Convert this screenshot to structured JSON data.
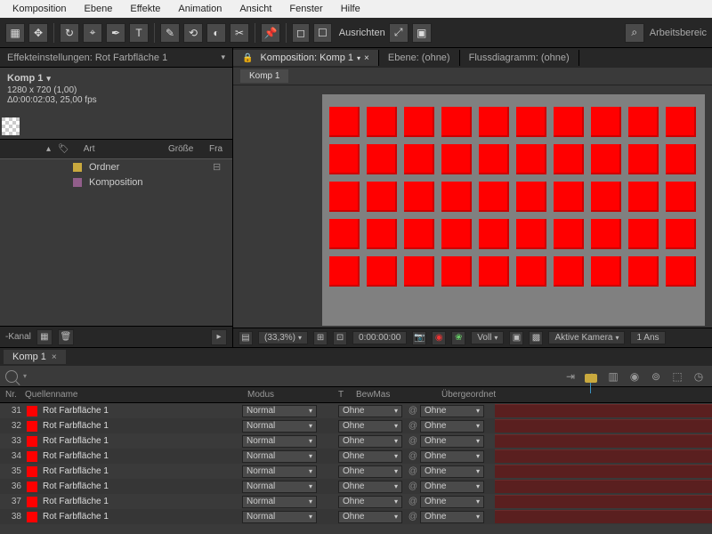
{
  "menu": [
    "Komposition",
    "Ebene",
    "Effekte",
    "Animation",
    "Ansicht",
    "Fenster",
    "Hilfe"
  ],
  "toolbar": {
    "ausrichten": "Ausrichten",
    "arbeitsbereich": "Arbeitsbereic"
  },
  "fx": {
    "title": "Effekteinstellungen: Rot Farbfläche 1"
  },
  "comp": {
    "name": "Komp 1",
    "dims": "1280 x 720 (1,00)",
    "fps": "Δ0:00:02:03, 25,00 fps"
  },
  "proj": {
    "cols": {
      "art": "Art",
      "size": "Größe",
      "fr": "Fra"
    },
    "items": [
      {
        "name": "Ordner",
        "kind": "folder"
      },
      {
        "name": "Komposition",
        "kind": "comp"
      }
    ],
    "kanal": "-Kanal"
  },
  "viewerTabs": {
    "komp": "Komposition: Komp 1",
    "ebene": "Ebene: (ohne)",
    "fluss": "Flussdiagramm: (ohne)",
    "subtab": "Komp 1"
  },
  "viewerFoot": {
    "zoom": "(33,3%)",
    "time": "0:00:00:00",
    "voll": "Voll",
    "cam": "Aktive Kamera",
    "ans": "1 Ans"
  },
  "timeline": {
    "tab": "Komp 1",
    "cols": {
      "nr": "Nr.",
      "name": "Quellenname",
      "mode": "Modus",
      "t": "T",
      "bew": "BewMas",
      "parent": "Übergeordnet"
    },
    "modeVal": "Normal",
    "bewVal": "Ohne",
    "parVal": "Ohne",
    "rows": [
      {
        "nr": "31",
        "name": "Rot Farbfläche 1"
      },
      {
        "nr": "32",
        "name": "Rot Farbfläche 1"
      },
      {
        "nr": "33",
        "name": "Rot Farbfläche 1"
      },
      {
        "nr": "34",
        "name": "Rot Farbfläche 1"
      },
      {
        "nr": "35",
        "name": "Rot Farbfläche 1"
      },
      {
        "nr": "36",
        "name": "Rot Farbfläche 1"
      },
      {
        "nr": "37",
        "name": "Rot Farbfläche 1"
      },
      {
        "nr": "38",
        "name": "Rot Farbfläche 1"
      }
    ]
  }
}
